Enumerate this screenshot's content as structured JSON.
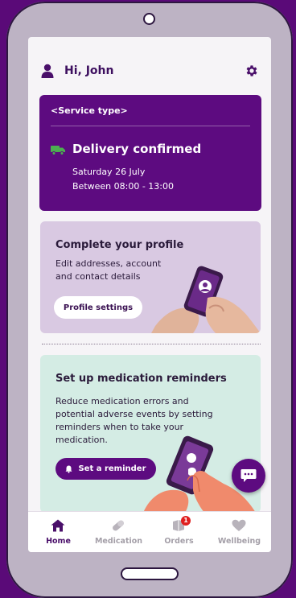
{
  "header": {
    "greeting": "Hi, John"
  },
  "delivery_card": {
    "service_type": "<Service type>",
    "status": "Delivery confirmed",
    "date": "Saturday 26 July",
    "time_window": "Between 08:00 - 13:00"
  },
  "profile_card": {
    "title": "Complete your profile",
    "desc_line1": "Edit addresses, account",
    "desc_line2": "and contact details",
    "button": "Profile settings"
  },
  "reminder_card": {
    "title": "Set up medication reminders",
    "description": "Reduce medication errors and potential adverse events by setting reminders when to take your medication.",
    "button": "Set a reminder"
  },
  "tabs": [
    {
      "label": "Home",
      "icon": "home-icon",
      "active": true
    },
    {
      "label": "Medication",
      "icon": "pill-icon",
      "active": false
    },
    {
      "label": "Orders",
      "icon": "orders-icon",
      "active": false,
      "badge": "1"
    },
    {
      "label": "Wellbeing",
      "icon": "heart-icon",
      "active": false
    }
  ],
  "colors": {
    "brand_purple": "#5d0b80",
    "profile_card_bg": "#d9c9e2",
    "reminder_card_bg": "#d4ece4",
    "truck_green": "#4caf50",
    "badge_red": "#e02020"
  }
}
